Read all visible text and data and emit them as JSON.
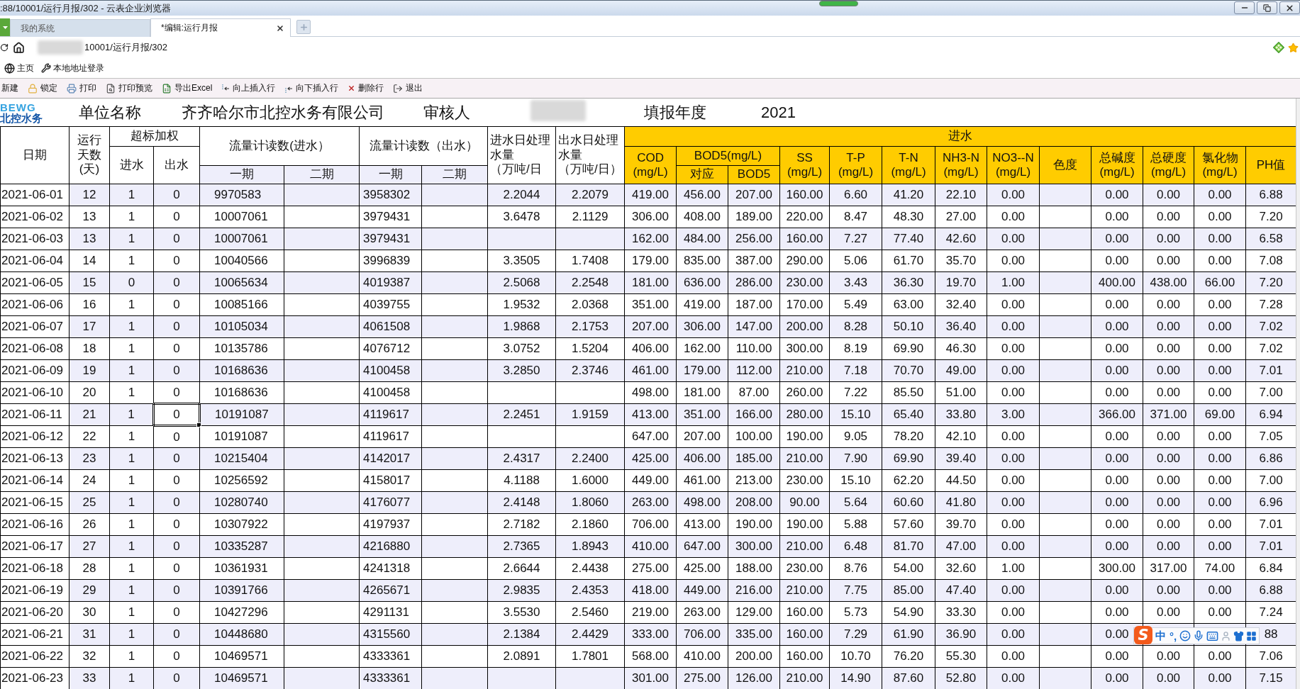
{
  "window": {
    "title": ":88/10001/运行月报/302 - 云表企业浏览器"
  },
  "tabs": [
    {
      "label": "我的系统",
      "selected": false
    },
    {
      "label": "*编辑:运行月报",
      "selected": true
    }
  ],
  "address_bar": {
    "host_redacted": true,
    "path": "10001/运行月报/302"
  },
  "bookmarks": [
    {
      "label": "主页",
      "kind": "home"
    },
    {
      "label": "本地地址登录",
      "kind": "tool"
    }
  ],
  "toolbar": [
    {
      "label": "新建",
      "kind": "new"
    },
    {
      "label": "锁定",
      "kind": "lock"
    },
    {
      "label": "打印",
      "kind": "print"
    },
    {
      "label": "打印预览",
      "kind": "preview"
    },
    {
      "label": "导出Excel",
      "kind": "excel"
    },
    {
      "label": "向上插入行",
      "kind": "insert_above"
    },
    {
      "label": "向下插入行",
      "kind": "insert_below"
    },
    {
      "label": "删除行",
      "kind": "delete"
    },
    {
      "label": "退出",
      "kind": "exit"
    }
  ],
  "sheet": {
    "logo": {
      "latin": "BEWG",
      "chinese": "北控水务"
    },
    "fields": [
      {
        "label": "单位名称",
        "value": "齐齐哈尔市北控水务有限公司",
        "redacted": false
      },
      {
        "label": "审核人",
        "redacted": true
      },
      {
        "label": "填报年度",
        "value": "2021",
        "redacted": false
      }
    ],
    "table": {
      "headers": [
        {
          "label": "日期",
          "selected": false,
          "highlighted": false
        },
        {
          "label": "运行天数(天)",
          "selected": false,
          "highlighted": false
        },
        {
          "label": "超标加权",
          "highlighted": false,
          "children": [
            {
              "label": "进水",
              "selected": false
            },
            {
              "label": "出水",
              "selected": true
            }
          ]
        },
        {
          "label": "流量计读数(进水）",
          "highlighted": false,
          "children": [
            {
              "label": "一期",
              "selected": false
            },
            {
              "label": "二期",
              "selected": false
            }
          ]
        },
        {
          "label": "流量计读数（出水）",
          "highlighted": false,
          "children": [
            {
              "label": "一期",
              "selected": false
            },
            {
              "label": "二期",
              "selected": false
            }
          ]
        },
        {
          "label": "进水日处理水量",
          "unit": "（万吨/日",
          "selected": false,
          "highlighted": false
        },
        {
          "label": "出水日处理水量",
          "unit": "（万吨/日）",
          "selected": false,
          "highlighted": false
        },
        {
          "label": "进水",
          "highlighted": true,
          "children": [
            {
              "label": "COD\n(mg/L)",
              "selected": false
            },
            {
              "label": "BOD5(mg/L)",
              "children": [
                {
                  "label": "对应",
                  "selected": false
                },
                {
                  "label": "BOD5",
                  "selected": false
                }
              ]
            },
            {
              "label": "SS\n(mg/L)",
              "selected": false
            },
            {
              "label": "T-P\n(mg/L)",
              "selected": false
            },
            {
              "label": "T-N\n(mg/L)",
              "selected": false
            },
            {
              "label": "NH3-N\n(mg/L)",
              "selected": false
            },
            {
              "label": "NO3--N\n(mg/L)",
              "selected": false
            },
            {
              "label": "色度",
              "selected": false
            },
            {
              "label": "总碱度\n(mg/L)",
              "selected": false
            },
            {
              "label": "总硬度\n(mg/L)",
              "selected": false
            },
            {
              "label": "氯化物\n(mg/L)",
              "selected": false
            },
            {
              "label": "PH值",
              "selected": false
            }
          ]
        }
      ],
      "rows": [
        {
          "selected": false,
          "cells": [
            "2021-06-01",
            "12",
            "1",
            "0",
            "9970583",
            null,
            "3958302",
            null,
            "2.2044",
            "2.2079",
            "419.00",
            "456.00",
            "207.00",
            "160.00",
            "6.60",
            "41.20",
            "22.10",
            "0.00",
            null,
            "0.00",
            "0.00",
            "0.00",
            "6.88"
          ]
        },
        {
          "selected": false,
          "cells": [
            "2021-06-02",
            "13",
            "1",
            "0",
            "10007061",
            null,
            "3979431",
            null,
            "3.6478",
            "2.1129",
            "306.00",
            "408.00",
            "189.00",
            "220.00",
            "8.47",
            "48.30",
            "27.00",
            "0.00",
            null,
            "0.00",
            "0.00",
            "0.00",
            "7.20"
          ]
        },
        {
          "selected": false,
          "cells": [
            "2021-06-03",
            "13",
            "1",
            "0",
            "10007061",
            null,
            "3979431",
            null,
            null,
            null,
            "162.00",
            "484.00",
            "256.00",
            "160.00",
            "7.27",
            "77.40",
            "42.60",
            "0.00",
            null,
            "0.00",
            "0.00",
            "0.00",
            "6.58"
          ]
        },
        {
          "selected": false,
          "cells": [
            "2021-06-04",
            "14",
            "1",
            "0",
            "10040566",
            null,
            "3996839",
            null,
            "3.3505",
            "1.7408",
            "179.00",
            "835.00",
            "387.00",
            "290.00",
            "5.06",
            "61.70",
            "35.70",
            "0.00",
            null,
            "0.00",
            "0.00",
            "0.00",
            "7.08"
          ]
        },
        {
          "selected": false,
          "cells": [
            "2021-06-05",
            "15",
            "0",
            "0",
            "10065634",
            null,
            "4019387",
            null,
            "2.5068",
            "2.2548",
            "181.00",
            "636.00",
            "286.00",
            "230.00",
            "3.43",
            "36.30",
            "19.70",
            "1.00",
            null,
            "400.00",
            "438.00",
            "66.00",
            "7.20"
          ]
        },
        {
          "selected": false,
          "cells": [
            "2021-06-06",
            "16",
            "1",
            "0",
            "10085166",
            null,
            "4039755",
            null,
            "1.9532",
            "2.0368",
            "351.00",
            "419.00",
            "187.00",
            "170.00",
            "5.49",
            "63.00",
            "32.40",
            "0.00",
            null,
            "0.00",
            "0.00",
            "0.00",
            "7.28"
          ]
        },
        {
          "selected": false,
          "cells": [
            "2021-06-07",
            "17",
            "1",
            "0",
            "10105034",
            null,
            "4061508",
            null,
            "1.9868",
            "2.1753",
            "207.00",
            "306.00",
            "147.00",
            "200.00",
            "8.28",
            "50.10",
            "36.40",
            "0.00",
            null,
            "0.00",
            "0.00",
            "0.00",
            "7.02"
          ]
        },
        {
          "selected": false,
          "cells": [
            "2021-06-08",
            "18",
            "1",
            "0",
            "10135786",
            null,
            "4076712",
            null,
            "3.0752",
            "1.5204",
            "406.00",
            "162.00",
            "110.00",
            "300.00",
            "8.19",
            "69.90",
            "46.30",
            "0.00",
            null,
            "0.00",
            "0.00",
            "0.00",
            "7.02"
          ]
        },
        {
          "selected": false,
          "cells": [
            "2021-06-09",
            "19",
            "1",
            "0",
            "10168636",
            null,
            "4100458",
            null,
            "3.2850",
            "2.3746",
            "461.00",
            "179.00",
            "112.00",
            "210.00",
            "7.18",
            "70.70",
            "49.00",
            "0.00",
            null,
            "0.00",
            "0.00",
            "0.00",
            "7.01"
          ]
        },
        {
          "selected": false,
          "cells": [
            "2021-06-10",
            "20",
            "1",
            "0",
            "10168636",
            null,
            "4100458",
            null,
            null,
            null,
            "498.00",
            "181.00",
            "87.00",
            "260.00",
            "7.22",
            "85.50",
            "51.00",
            "0.00",
            null,
            "0.00",
            "0.00",
            "0.00",
            "7.00"
          ]
        },
        {
          "selected": true,
          "cells": [
            "2021-06-11",
            "21",
            "1",
            "0",
            "10191087",
            null,
            "4119617",
            null,
            "2.2451",
            "1.9159",
            "413.00",
            "351.00",
            "166.00",
            "280.00",
            "15.10",
            "65.40",
            "33.80",
            "3.00",
            null,
            "366.00",
            "371.00",
            "69.00",
            "6.94"
          ]
        },
        {
          "selected": false,
          "cells": [
            "2021-06-12",
            "22",
            "1",
            "0",
            "10191087",
            null,
            "4119617",
            null,
            null,
            null,
            "647.00",
            "207.00",
            "100.00",
            "190.00",
            "9.05",
            "78.20",
            "42.10",
            "0.00",
            null,
            "0.00",
            "0.00",
            "0.00",
            "7.05"
          ]
        },
        {
          "selected": false,
          "cells": [
            "2021-06-13",
            "23",
            "1",
            "0",
            "10215404",
            null,
            "4142017",
            null,
            "2.4317",
            "2.2400",
            "425.00",
            "406.00",
            "185.00",
            "210.00",
            "7.90",
            "69.90",
            "39.40",
            "0.00",
            null,
            "0.00",
            "0.00",
            "0.00",
            "6.86"
          ]
        },
        {
          "selected": false,
          "cells": [
            "2021-06-14",
            "24",
            "1",
            "0",
            "10256592",
            null,
            "4158017",
            null,
            "4.1188",
            "1.6000",
            "449.00",
            "461.00",
            "213.00",
            "230.00",
            "15.10",
            "62.20",
            "44.50",
            "0.00",
            null,
            "0.00",
            "0.00",
            "0.00",
            "7.00"
          ]
        },
        {
          "selected": false,
          "cells": [
            "2021-06-15",
            "25",
            "1",
            "0",
            "10280740",
            null,
            "4176077",
            null,
            "2.4148",
            "1.8060",
            "263.00",
            "498.00",
            "208.00",
            "90.00",
            "5.64",
            "60.60",
            "41.80",
            "0.00",
            null,
            "0.00",
            "0.00",
            "0.00",
            "6.96"
          ]
        },
        {
          "selected": false,
          "cells": [
            "2021-06-16",
            "26",
            "1",
            "0",
            "10307922",
            null,
            "4197937",
            null,
            "2.7182",
            "2.1860",
            "706.00",
            "413.00",
            "190.00",
            "190.00",
            "5.88",
            "57.60",
            "39.70",
            "0.00",
            null,
            "0.00",
            "0.00",
            "0.00",
            "7.01"
          ]
        },
        {
          "selected": false,
          "cells": [
            "2021-06-17",
            "27",
            "1",
            "0",
            "10335287",
            null,
            "4216880",
            null,
            "2.7365",
            "1.8943",
            "410.00",
            "647.00",
            "300.00",
            "210.00",
            "6.48",
            "81.70",
            "47.00",
            "0.00",
            null,
            "0.00",
            "0.00",
            "0.00",
            "7.01"
          ]
        },
        {
          "selected": false,
          "cells": [
            "2021-06-18",
            "28",
            "1",
            "0",
            "10361931",
            null,
            "4241318",
            null,
            "2.6644",
            "2.4438",
            "275.00",
            "425.00",
            "188.00",
            "230.00",
            "8.76",
            "54.00",
            "32.60",
            "1.00",
            null,
            "300.00",
            "317.00",
            "74.00",
            "6.84"
          ]
        },
        {
          "selected": false,
          "cells": [
            "2021-06-19",
            "29",
            "1",
            "0",
            "10391766",
            null,
            "4265671",
            null,
            "2.9835",
            "2.4353",
            "418.00",
            "449.00",
            "216.00",
            "210.00",
            "7.75",
            "85.00",
            "47.40",
            "0.00",
            null,
            "0.00",
            "0.00",
            "0.00",
            "6.88"
          ]
        },
        {
          "selected": false,
          "cells": [
            "2021-06-20",
            "30",
            "1",
            "0",
            "10427296",
            null,
            "4291131",
            null,
            "3.5530",
            "2.5460",
            "219.00",
            "263.00",
            "129.00",
            "160.00",
            "5.73",
            "54.90",
            "33.30",
            "0.00",
            null,
            "0.00",
            "0.00",
            "0.00",
            "7.24"
          ]
        },
        {
          "selected": false,
          "cells": [
            "2021-06-21",
            "31",
            "1",
            "0",
            "10448680",
            null,
            "4315560",
            null,
            "2.1384",
            "2.4429",
            "333.00",
            "706.00",
            "335.00",
            "160.00",
            "7.29",
            "61.90",
            "36.90",
            "0.00",
            null,
            "0.00",
            null,
            null,
            "88"
          ]
        },
        {
          "selected": false,
          "cells": [
            "2021-06-22",
            "32",
            "1",
            "0",
            "10469571",
            null,
            "4333361",
            null,
            "2.0891",
            "1.7801",
            "568.00",
            "410.00",
            "200.00",
            "160.00",
            "10.70",
            "76.20",
            "55.30",
            "0.00",
            null,
            "0.00",
            "0.00",
            "0.00",
            "7.06"
          ]
        },
        {
          "selected": false,
          "cells": [
            "2021-06-23",
            "33",
            "1",
            "0",
            "10469571",
            null,
            "4333361",
            null,
            null,
            null,
            "301.00",
            "275.00",
            "126.00",
            "210.00",
            "14.90",
            "87.60",
            "52.80",
            "0.00",
            null,
            "0.00",
            "0.00",
            "0.00",
            "7.15"
          ]
        }
      ]
    }
  },
  "ime_toolbar": {
    "logo": "S",
    "mode": "中",
    "punctuation": "°,"
  }
}
